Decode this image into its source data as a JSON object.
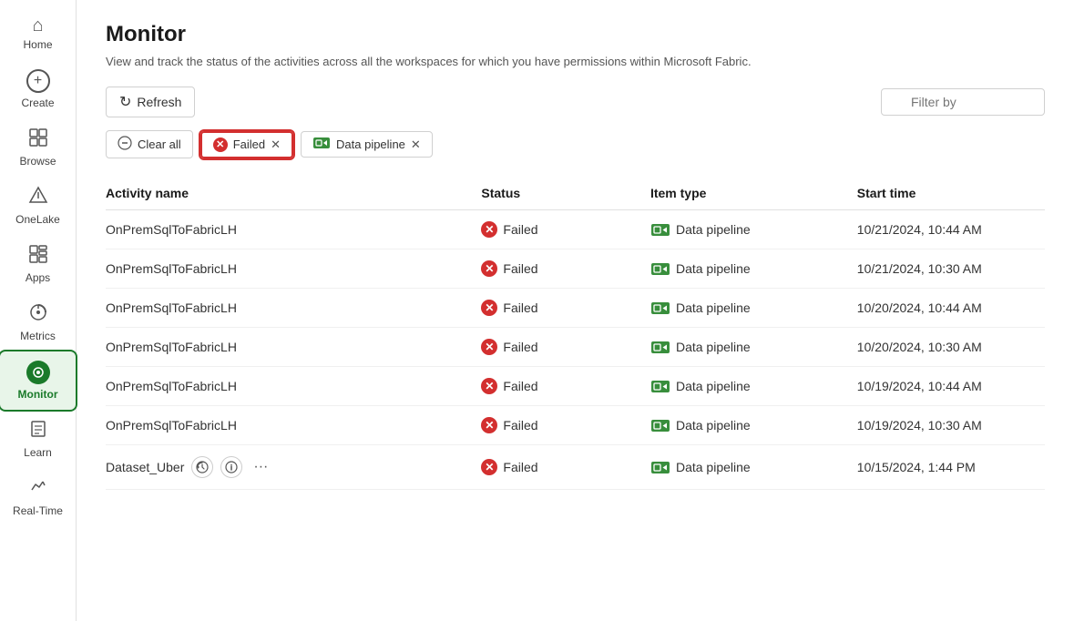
{
  "sidebar": {
    "items": [
      {
        "id": "home",
        "label": "Home",
        "icon": "⌂",
        "active": false
      },
      {
        "id": "create",
        "label": "Create",
        "icon": "+",
        "active": false,
        "circle": true
      },
      {
        "id": "browse",
        "label": "Browse",
        "icon": "▣",
        "active": false
      },
      {
        "id": "onelake",
        "label": "OneLake",
        "icon": "◈",
        "active": false
      },
      {
        "id": "apps",
        "label": "Apps",
        "icon": "⊞",
        "active": false
      },
      {
        "id": "metrics",
        "label": "Metrics",
        "icon": "⊙",
        "active": false
      },
      {
        "id": "monitor",
        "label": "Monitor",
        "icon": "●",
        "active": true
      },
      {
        "id": "learn",
        "label": "Learn",
        "icon": "📖",
        "active": false
      },
      {
        "id": "realtime",
        "label": "Real-Time",
        "icon": "⚡",
        "active": false
      }
    ]
  },
  "page": {
    "title": "Monitor",
    "subtitle": "View and track the status of the activities across all the workspaces for which you have permissions within Microsoft Fabric."
  },
  "toolbar": {
    "refresh_label": "Refresh",
    "filter_placeholder": "Filter by"
  },
  "chips": {
    "clear_all_label": "Clear all",
    "failed_label": "Failed",
    "pipeline_label": "Data pipeline"
  },
  "table": {
    "headers": [
      "Activity name",
      "Status",
      "Item type",
      "Start time"
    ],
    "rows": [
      {
        "name": "OnPremSqlToFabricLH",
        "status": "Failed",
        "item_type": "Data pipeline",
        "start_time": "10/21/2024, 10:44 AM",
        "show_actions": false
      },
      {
        "name": "OnPremSqlToFabricLH",
        "status": "Failed",
        "item_type": "Data pipeline",
        "start_time": "10/21/2024, 10:30 AM",
        "show_actions": false
      },
      {
        "name": "OnPremSqlToFabricLH",
        "status": "Failed",
        "item_type": "Data pipeline",
        "start_time": "10/20/2024, 10:44 AM",
        "show_actions": false
      },
      {
        "name": "OnPremSqlToFabricLH",
        "status": "Failed",
        "item_type": "Data pipeline",
        "start_time": "10/20/2024, 10:30 AM",
        "show_actions": false
      },
      {
        "name": "OnPremSqlToFabricLH",
        "status": "Failed",
        "item_type": "Data pipeline",
        "start_time": "10/19/2024, 10:44 AM",
        "show_actions": false
      },
      {
        "name": "OnPremSqlToFabricLH",
        "status": "Failed",
        "item_type": "Data pipeline",
        "start_time": "10/19/2024, 10:30 AM",
        "show_actions": false
      },
      {
        "name": "Dataset_Uber",
        "status": "Failed",
        "item_type": "Data pipeline",
        "start_time": "10/15/2024, 1:44 PM",
        "show_actions": true
      }
    ]
  },
  "icons": {
    "refresh": "↻",
    "search": "🔍",
    "clear_all": "⊖",
    "failed_x": "✕",
    "close_chip": "✕",
    "pipeline_symbol": "▶|",
    "row_history": "↺",
    "row_info": "ℹ",
    "row_more": "..."
  }
}
